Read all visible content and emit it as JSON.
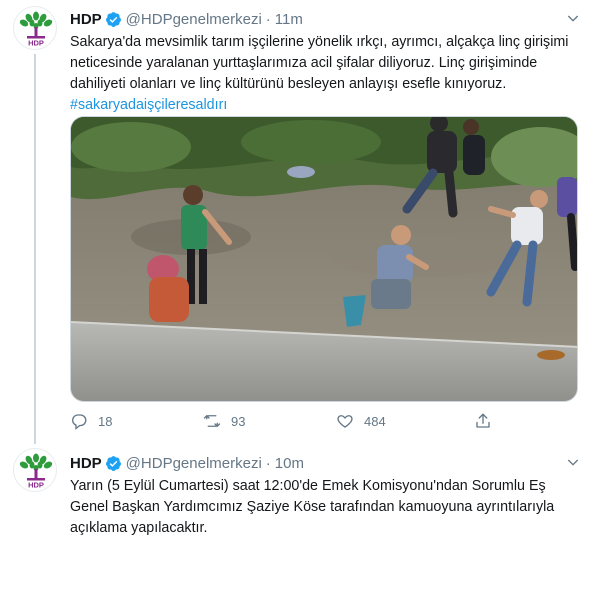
{
  "tweets": [
    {
      "author_name": "HDP",
      "handle": "@HDPgenelmerkezi",
      "separator": "·",
      "time": "11m",
      "text": "Sakarya'da mevsimlik tarım işçilerine yönelik ırkçı, ayrımcı, alçakça linç girişimi neticesinde yaralanan yurttaşlarımıza acil şifalar diliyoruz. Linç girişiminde dahiliyeti olanları ve linç kültürünü besleyen anlayışı esefle kınıyoruz.",
      "hashtag": "#sakaryadaişçileresaldırı",
      "stats": {
        "replies": "18",
        "retweets": "93",
        "likes": "484"
      }
    },
    {
      "author_name": "HDP",
      "handle": "@HDPgenelmerkezi",
      "separator": "·",
      "time": "10m",
      "text": "Yarın (5 Eylül Cumartesi) saat 12:00'de Emek Komisyonu'ndan Sorumlu Eş Genel Başkan Yardımcımız Şaziye Köse tarafından kamuoyuna ayrıntılarıyla açıklama yapılacaktır."
    }
  ],
  "colors": {
    "link": "#1b95e0",
    "verified": "#1da1f2",
    "muted": "#657786",
    "logo_green": "#2e9b3c",
    "logo_purple": "#8a2a8c"
  },
  "icons": [
    "hdp-logo-icon",
    "verified-icon",
    "chevron-down-icon",
    "reply-icon",
    "retweet-icon",
    "like-icon",
    "share-icon"
  ]
}
